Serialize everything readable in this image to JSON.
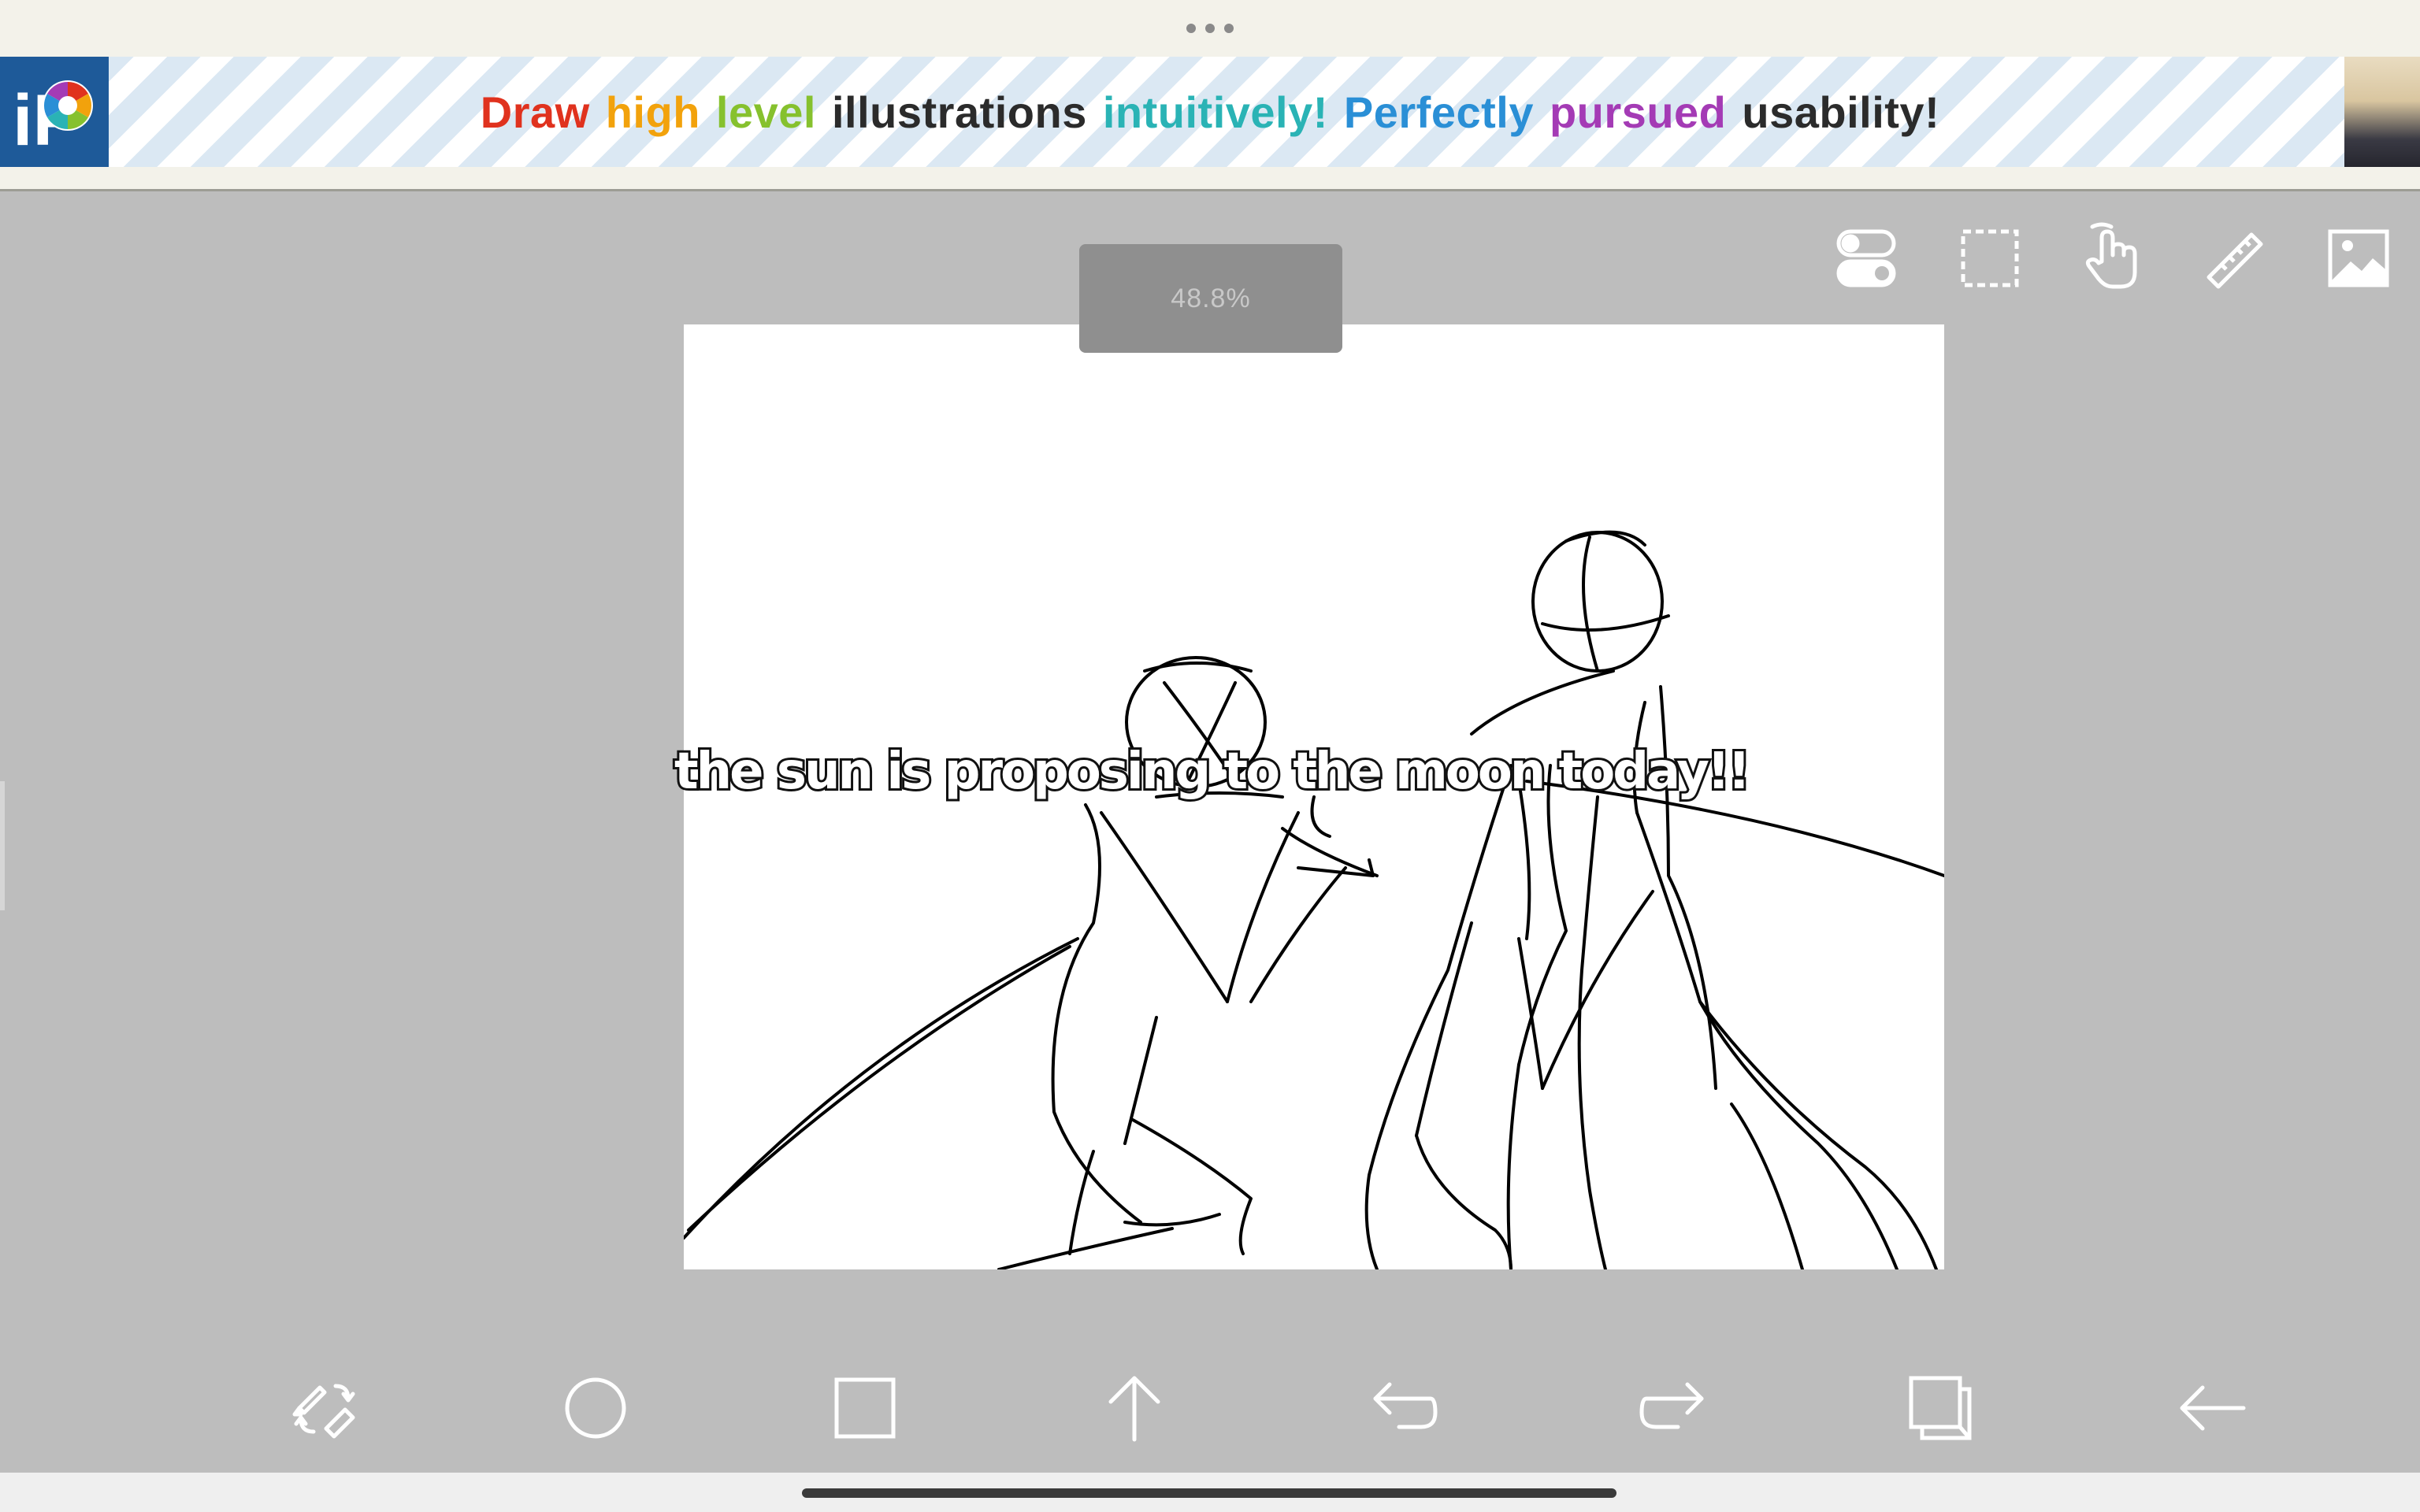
{
  "ad": {
    "words": [
      {
        "text": "Draw",
        "color": "#e0321e"
      },
      {
        "text": "high",
        "color": "#f2a20c"
      },
      {
        "text": "level",
        "color": "#86c12e"
      },
      {
        "text": "illustrations",
        "color": "#2b2b2b"
      },
      {
        "text": "intuitively!",
        "color": "#2ab3b5"
      },
      {
        "text": "Perfectly",
        "color": "#2a8fd6"
      },
      {
        "text": "pursued",
        "color": "#a43bb5"
      },
      {
        "text": "usability!",
        "color": "#2b2b2b"
      }
    ],
    "logo_letters": "iP"
  },
  "canvas": {
    "zoom_label": "48.8%",
    "caption": "the sun is proposing to the moon today!!"
  },
  "top_toolbar": [
    {
      "name": "toggle-icon"
    },
    {
      "name": "selection-icon"
    },
    {
      "name": "hand-icon"
    },
    {
      "name": "ruler-icon"
    },
    {
      "name": "image-icon"
    }
  ],
  "bottom_toolbar": [
    {
      "name": "brush-eraser-swap-icon"
    },
    {
      "name": "circle-icon"
    },
    {
      "name": "square-icon"
    },
    {
      "name": "arrow-up-icon"
    },
    {
      "name": "undo-icon"
    },
    {
      "name": "redo-icon"
    },
    {
      "name": "layers-icon"
    },
    {
      "name": "back-arrow-icon"
    }
  ],
  "colors": {
    "workspace": "#bdbdbd",
    "icon": "#ffffff",
    "ad_stripe": "#dbe8f3",
    "logo_bg": "#1e5a99"
  }
}
